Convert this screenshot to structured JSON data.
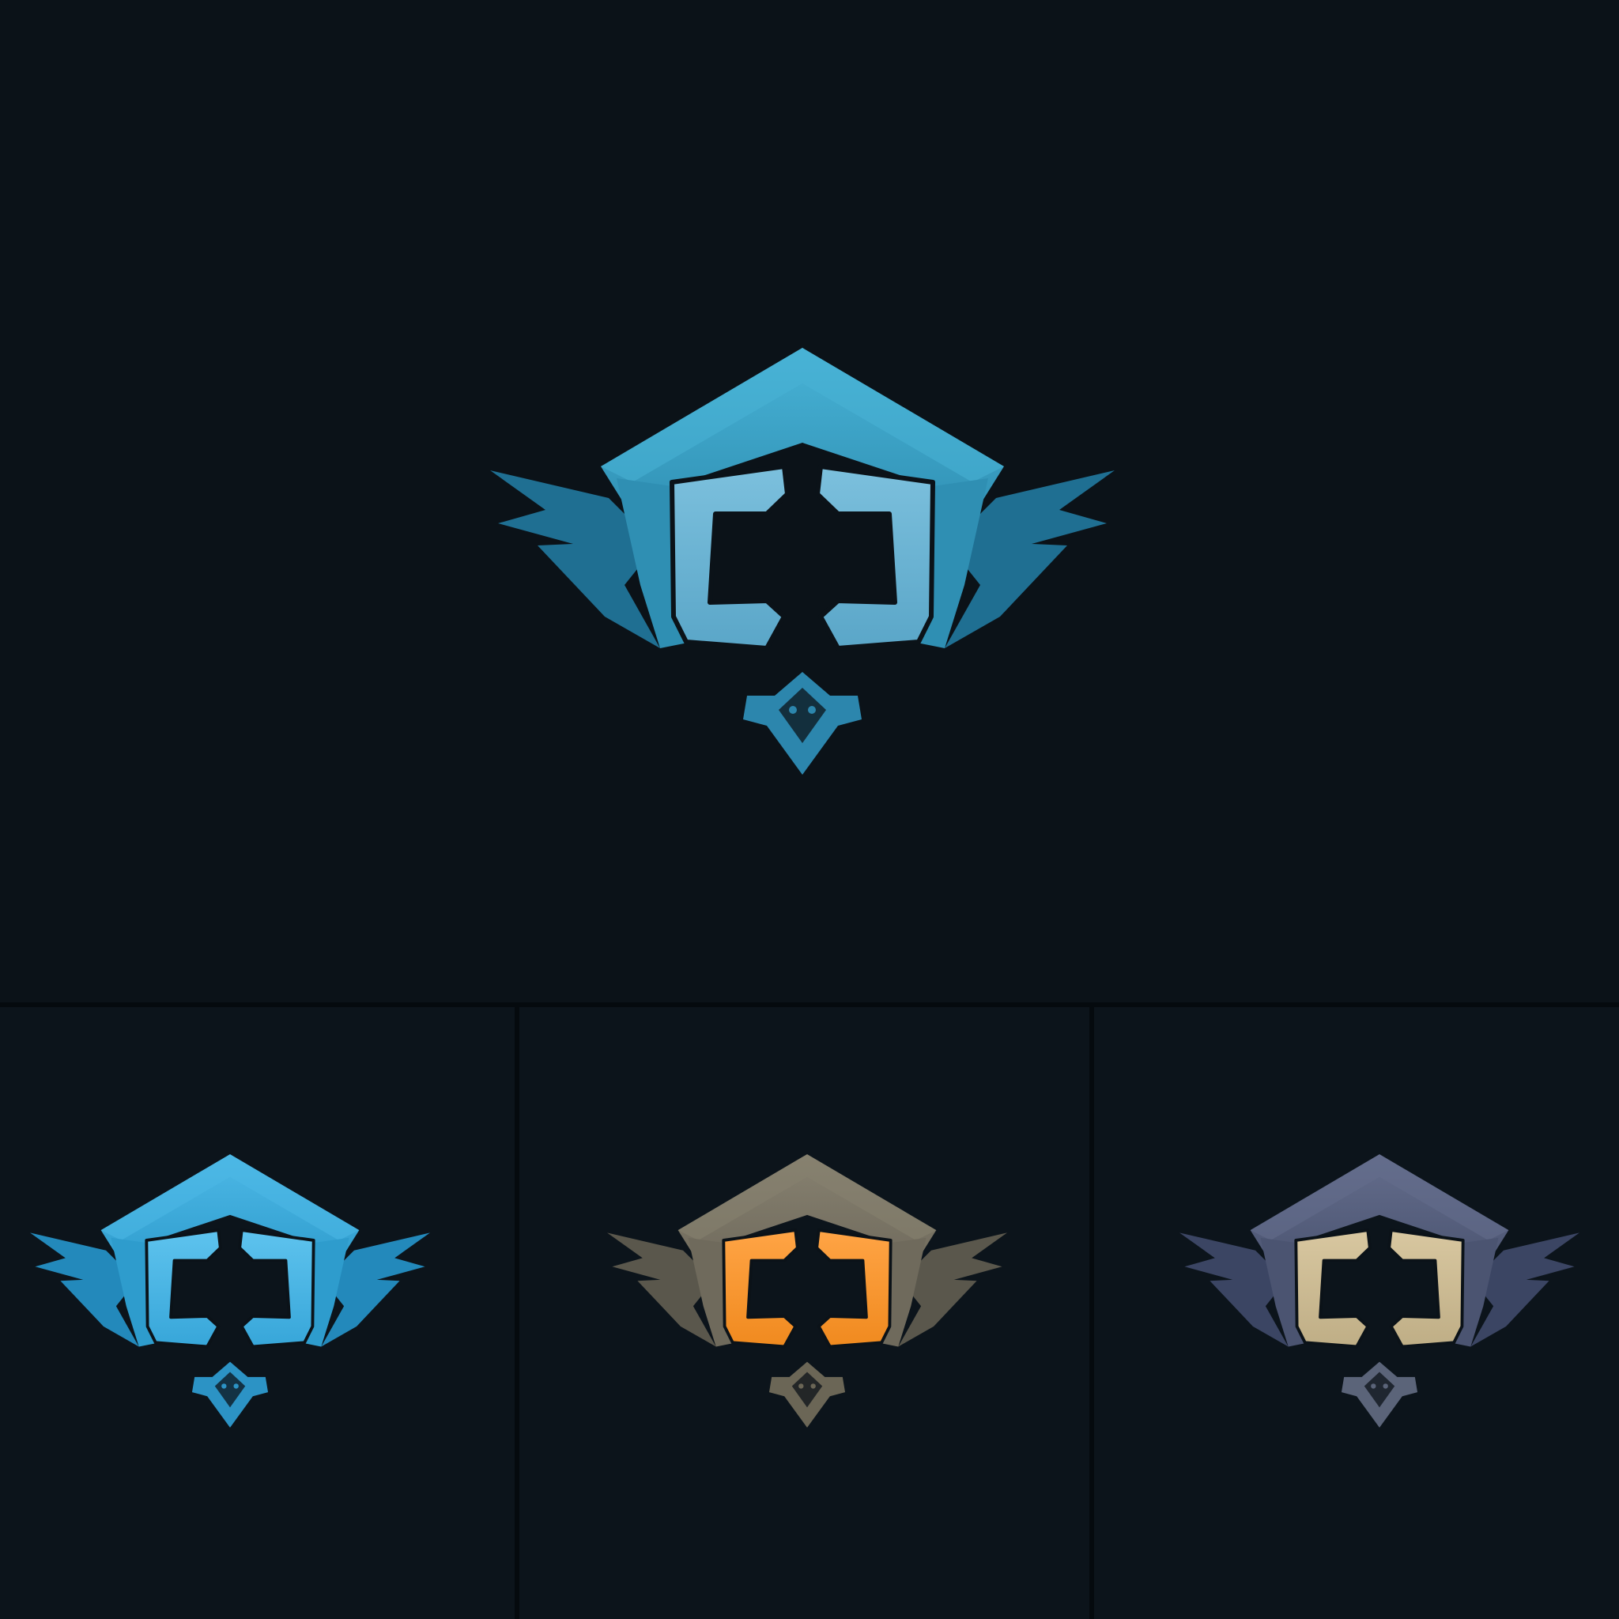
{
  "canvas": {
    "background": "#0b1218",
    "divider_color": "#050a0e"
  },
  "logo": {
    "lettering": "CJ",
    "mark_name": "winged-shield-monogram"
  },
  "variants": [
    {
      "name": "hero",
      "shield": "#2f8fb3",
      "shield_light": "#48b3d6",
      "wings": "#1f6f92",
      "letters": "#5aa6c8",
      "letters_light": "#7cc0dd",
      "badge": "#2c86ad"
    },
    {
      "name": "blue",
      "shield": "#2e9ccd",
      "shield_light": "#4db8e6",
      "wings": "#2389bb",
      "letters": "#37a6d9",
      "letters_light": "#5ec3ee",
      "badge": "#2c93c5"
    },
    {
      "name": "orange",
      "shield": "#6f6a5c",
      "shield_light": "#878170",
      "wings": "#5a574c",
      "letters": "#f08a1f",
      "letters_light": "#ffa445",
      "badge": "#6b6656"
    },
    {
      "name": "slate",
      "shield": "#4b5471",
      "shield_light": "#646d8c",
      "wings": "#3b4563",
      "letters": "#bfae86",
      "letters_light": "#d8c7a0",
      "badge": "#5b6479"
    }
  ]
}
